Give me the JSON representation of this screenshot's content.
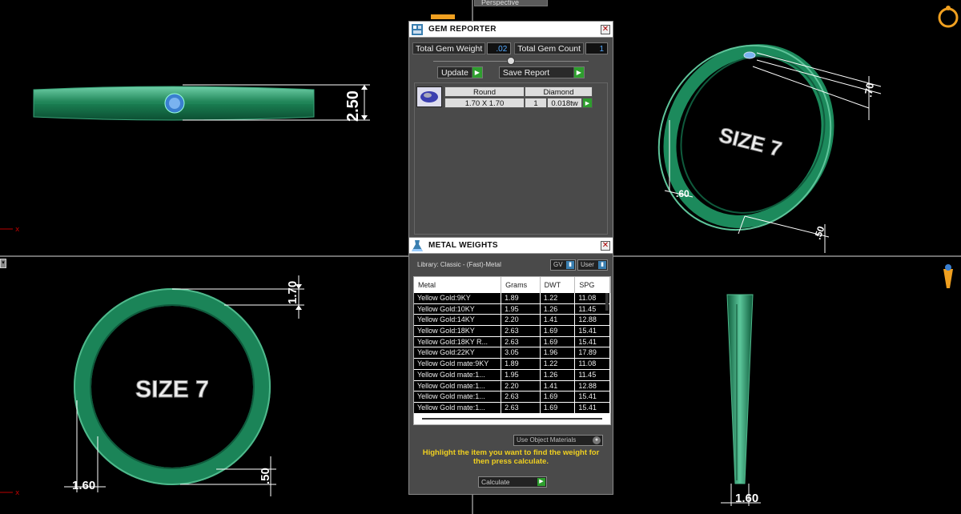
{
  "viewport": {
    "perspective_tab": "Perspective",
    "axis_x_label": "x"
  },
  "dimensions": {
    "front_height": "2.50",
    "top_width": "1.70",
    "top_thickness": "1.60",
    "top_bottom": ".50",
    "persp_a": ".70",
    "persp_b": ".60",
    "persp_c": ".50",
    "side_width": "1.60"
  },
  "engraving": {
    "top_view": "SIZE 7",
    "perspective_view": "SIZE 7"
  },
  "gem_reporter": {
    "title": "GEM REPORTER",
    "total_weight_label": "Total Gem Weight",
    "total_weight_value": ".02",
    "total_count_label": "Total Gem Count",
    "total_count_value": "1",
    "update_label": "Update",
    "save_report_label": "Save Report",
    "headers": {
      "shape": "Round",
      "type": "Diamond"
    },
    "row": {
      "size": "1.70 X 1.70",
      "count": "1",
      "weight": "0.018tw"
    }
  },
  "metal_weights": {
    "title": "METAL WEIGHTS",
    "library_label": "Library: Classic - (Fast)-Metal",
    "gv_label": "GV",
    "user_label": "User",
    "columns": [
      "Metal",
      "Grams",
      "DWT",
      "SPG"
    ],
    "rows": [
      [
        "Yellow Gold:9KY",
        "1.89",
        "1.22",
        "11.08"
      ],
      [
        "Yellow Gold:10KY",
        "1.95",
        "1.26",
        "11.45"
      ],
      [
        "Yellow Gold:14KY",
        "2.20",
        "1.41",
        "12.88"
      ],
      [
        "Yellow Gold:18KY",
        "2.63",
        "1.69",
        "15.41"
      ],
      [
        "Yellow Gold:18KY R...",
        "2.63",
        "1.69",
        "15.41"
      ],
      [
        "Yellow Gold:22KY",
        "3.05",
        "1.96",
        "17.89"
      ],
      [
        "Yellow Gold mate:9KY",
        "1.89",
        "1.22",
        "11.08"
      ],
      [
        "Yellow Gold mate:1...",
        "1.95",
        "1.26",
        "11.45"
      ],
      [
        "Yellow Gold mate:1...",
        "2.20",
        "1.41",
        "12.88"
      ],
      [
        "Yellow Gold mate:1...",
        "2.63",
        "1.69",
        "15.41"
      ],
      [
        "Yellow Gold mate:1...",
        "2.63",
        "1.69",
        "15.41"
      ]
    ],
    "use_object_materials": "Use Object Materials",
    "highlight_message": "Highlight the item you want to find the weight for then press calculate.",
    "calculate_label": "Calculate"
  },
  "colors": {
    "ring_green": "#1f8f5f",
    "accent_yellow": "#f0d020",
    "button_green": "#2e9e2e"
  }
}
